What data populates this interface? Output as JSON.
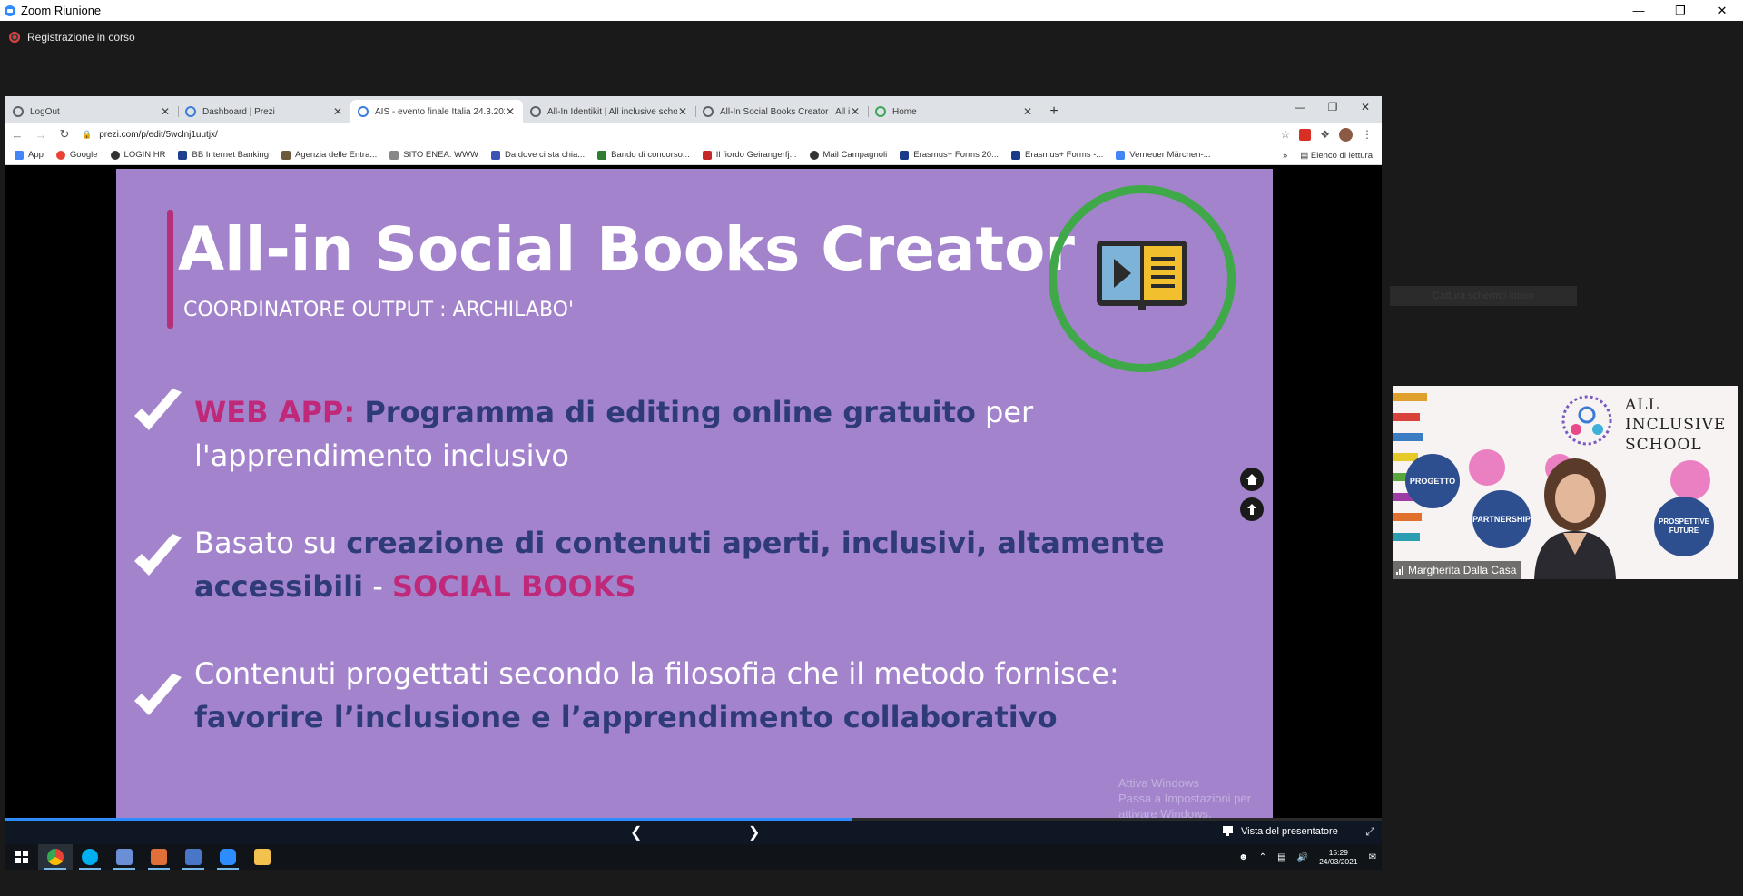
{
  "zoom": {
    "title": "Zoom Riunione",
    "recording_label": "Registrazione in corso",
    "capture_button": "Cattura schermo intero"
  },
  "browser": {
    "tabs": [
      {
        "label": "LogOut",
        "color": "#5f6368"
      },
      {
        "label": "Dashboard | Prezi",
        "color": "#3b7ddd"
      },
      {
        "label": "AIS - evento finale Italia 24.3.2021",
        "color": "#3b7ddd"
      },
      {
        "label": "All-In Identikit | All inclusive scho",
        "color": "#5f6368"
      },
      {
        "label": "All-In Social Books Creator | All in",
        "color": "#5f6368"
      },
      {
        "label": "Home",
        "color": "#3aa757"
      }
    ],
    "url": "prezi.com/p/edit/5wclnj1uutjx/",
    "bookmarks": [
      {
        "label": "App",
        "color": "#4285f4"
      },
      {
        "label": "Google",
        "color": "#ea4335"
      },
      {
        "label": "LOGIN HR",
        "color": "#333333"
      },
      {
        "label": "BB Internet Banking",
        "color": "#1f3f8f"
      },
      {
        "label": "Agenzia delle Entra...",
        "color": "#6d5a3a"
      },
      {
        "label": "SITO ENEA: WWW",
        "color": "#888888"
      },
      {
        "label": "Da dove ci sta chia...",
        "color": "#3f51b5"
      },
      {
        "label": "Bando di concorso...",
        "color": "#2e7d32"
      },
      {
        "label": "Il fiordo Geirangerfj...",
        "color": "#c62828"
      },
      {
        "label": "Mail Campagnoli",
        "color": "#333333"
      },
      {
        "label": "Erasmus+ Forms 20...",
        "color": "#1a3a8a"
      },
      {
        "label": "Erasmus+ Forms -...",
        "color": "#1a3a8a"
      },
      {
        "label": "Verneuer Märchen-...",
        "color": "#4285f4"
      }
    ],
    "reading_list": "Elenco di lettura"
  },
  "slide": {
    "title": "All-in Social Books Creator",
    "subtitle": "COORDINATORE OUTPUT : ARCHILABO'",
    "bullet1": {
      "label": "WEB APP:",
      "highlight": "Programma di editing online gratuito",
      "rest": " per l'apprendimento inclusivo"
    },
    "bullet2": {
      "prefix": "Basato su ",
      "highlight": "creazione di contenuti aperti, inclusivi, altamente accessibili",
      "dash": " - ",
      "pink": "SOCIAL BOOKS"
    },
    "bullet3": {
      "prefix": "Contenuti  progettati secondo la filosofia che il metodo fornisce: ",
      "highlight": "favorire l’inclusione e l’apprendimento collaborativo"
    },
    "watermark_line1": "Attiva Windows",
    "watermark_line2": "Passa a Impostazioni per attivare Windows."
  },
  "prezi": {
    "progress": 0.615,
    "presenter_view": "Vista del presentatore"
  },
  "taskbar": {
    "time": "15:29",
    "date": "24/03/2021"
  },
  "participant": {
    "name": "Margherita Dalla Casa",
    "school_line1": "ALL",
    "school_line2": "INCLUSIVE",
    "school_line3": "SCHOOL",
    "bubble1": "PROGETTO",
    "bubble2": "PARTNERSHIP",
    "bubble3": "PROSPETTIVE FUTURE"
  }
}
